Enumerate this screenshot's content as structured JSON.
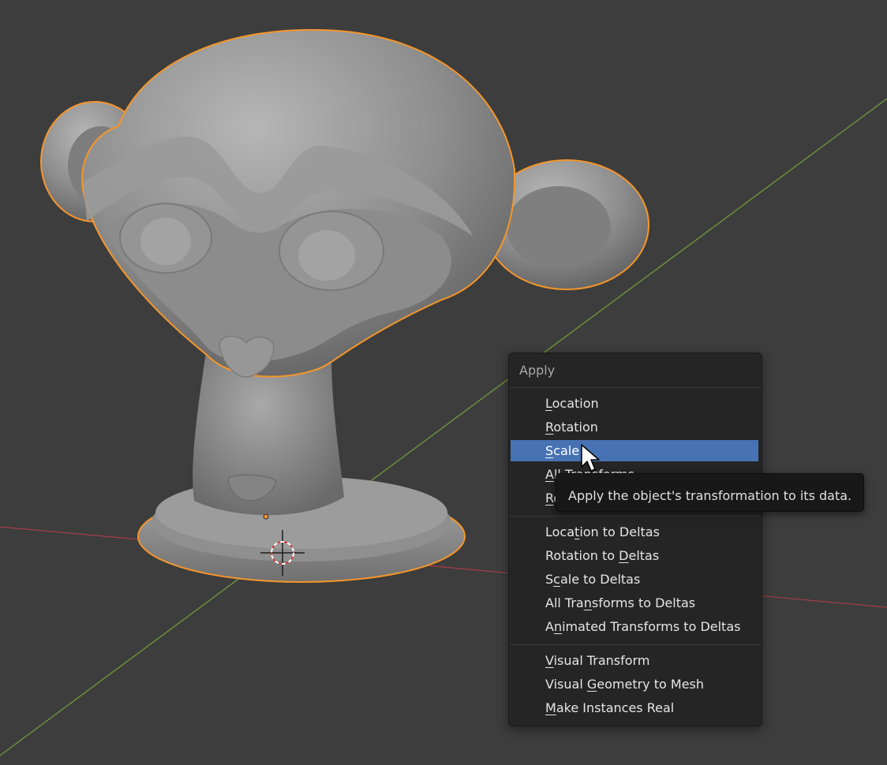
{
  "menu": {
    "title": "Apply",
    "groups": [
      [
        {
          "id": "location",
          "label": "Location",
          "mnemonic": "L"
        },
        {
          "id": "rotation",
          "label": "Rotation",
          "mnemonic": "R"
        },
        {
          "id": "scale",
          "label": "Scale",
          "mnemonic": "S",
          "active": true
        },
        {
          "id": "all-transforms",
          "label": "All Transforms",
          "mnemonic": "A"
        },
        {
          "id": "rotation-scale",
          "label": "Rotation & Scale",
          "mnemonic": "R"
        }
      ],
      [
        {
          "id": "location-to-deltas",
          "label": "Location to Deltas",
          "mnemonic": "t"
        },
        {
          "id": "rotation-to-deltas",
          "label": "Rotation to Deltas",
          "mnemonic": "D"
        },
        {
          "id": "scale-to-deltas",
          "label": "Scale to Deltas",
          "mnemonic": "c"
        },
        {
          "id": "all-transforms-to-deltas",
          "label": "All Transforms to Deltas",
          "mnemonic": "n"
        },
        {
          "id": "animated-transforms-to-deltas",
          "label": "Animated Transforms to Deltas",
          "mnemonic": "n"
        }
      ],
      [
        {
          "id": "visual-transform",
          "label": "Visual Transform",
          "mnemonic": "V"
        },
        {
          "id": "visual-geometry-to-mesh",
          "label": "Visual Geometry to Mesh",
          "mnemonic": "G"
        },
        {
          "id": "make-instances-real",
          "label": "Make Instances Real",
          "mnemonic": "M"
        }
      ]
    ]
  },
  "tooltip": {
    "text": "Apply the object's transformation to its data."
  },
  "colors": {
    "background": "#3d3d3d",
    "highlight": "#4772b3",
    "selection_outline": "#f5962b",
    "x_axis": "#a83c4b",
    "y_axis": "#6b8f3a"
  },
  "icons": {
    "cursor": "mouse-pointer-icon",
    "origin": "3d-cursor-icon"
  }
}
